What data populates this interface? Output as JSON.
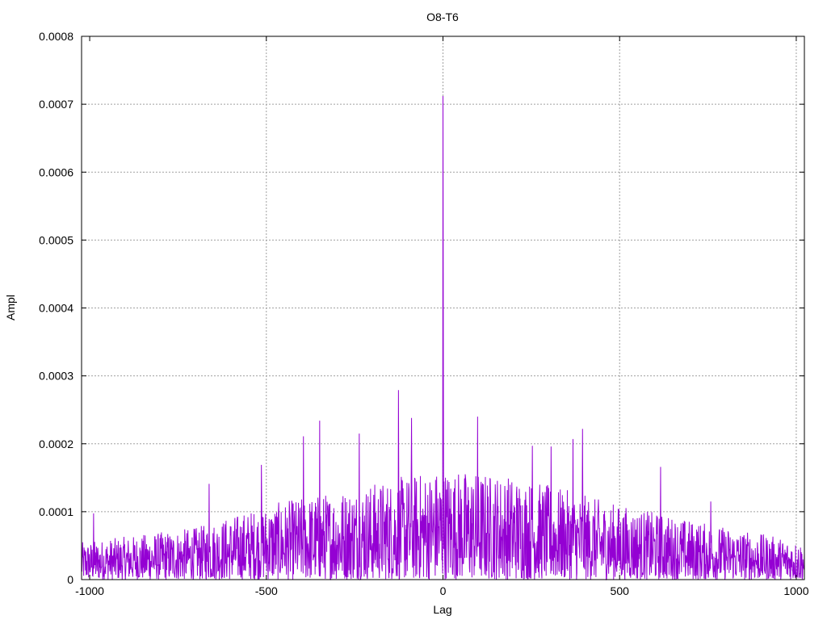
{
  "chart_data": {
    "type": "line",
    "title": "O8-T6",
    "xlabel": "Lag",
    "ylabel": "Ampl",
    "xlim": [
      -1023,
      1023
    ],
    "ylim": [
      0,
      0.0008
    ],
    "xticks": [
      -1000,
      -500,
      0,
      500,
      1000
    ],
    "xtick_labels": [
      "-1000",
      "-500",
      "0",
      "500",
      "1000"
    ],
    "yticks": [
      0,
      0.0001,
      0.0002,
      0.0003,
      0.0004,
      0.0005,
      0.0006,
      0.0007,
      0.0008
    ],
    "ytick_labels": [
      "0",
      "0.0001",
      "0.0002",
      "0.0003",
      "0.0004",
      "0.0005",
      "0.0006",
      "0.0007",
      "0.0008"
    ],
    "grid": true,
    "series_color": "#9400d3",
    "series": [
      {
        "name": "O8-T6",
        "peaks": [
          [
            0,
            0.000712
          ],
          [
            1,
            0.000355
          ],
          [
            -126,
            0.000279
          ],
          [
            98,
            0.00024
          ],
          [
            -89,
            0.000238
          ],
          [
            -349,
            0.000234
          ],
          [
            395,
            0.000222
          ],
          [
            -237,
            0.000215
          ],
          [
            -395,
            0.000211
          ],
          [
            368,
            0.000207
          ],
          [
            253,
            0.000197
          ],
          [
            306,
            0.000196
          ],
          [
            -514,
            0.000169
          ],
          [
            616,
            0.000166
          ],
          [
            -662,
            0.000141
          ],
          [
            758,
            0.000115
          ],
          [
            -989,
            9.75e-05
          ]
        ],
        "noise_envelope": [
          [
            -1023,
            5e-05
          ],
          [
            -700,
            7e-05
          ],
          [
            -500,
            0.0001
          ],
          [
            -200,
            0.00013
          ],
          [
            0,
            0.00015
          ],
          [
            200,
            0.00014
          ],
          [
            500,
            0.0001
          ],
          [
            700,
            8e-05
          ],
          [
            1023,
            5e-05
          ]
        ]
      }
    ]
  }
}
